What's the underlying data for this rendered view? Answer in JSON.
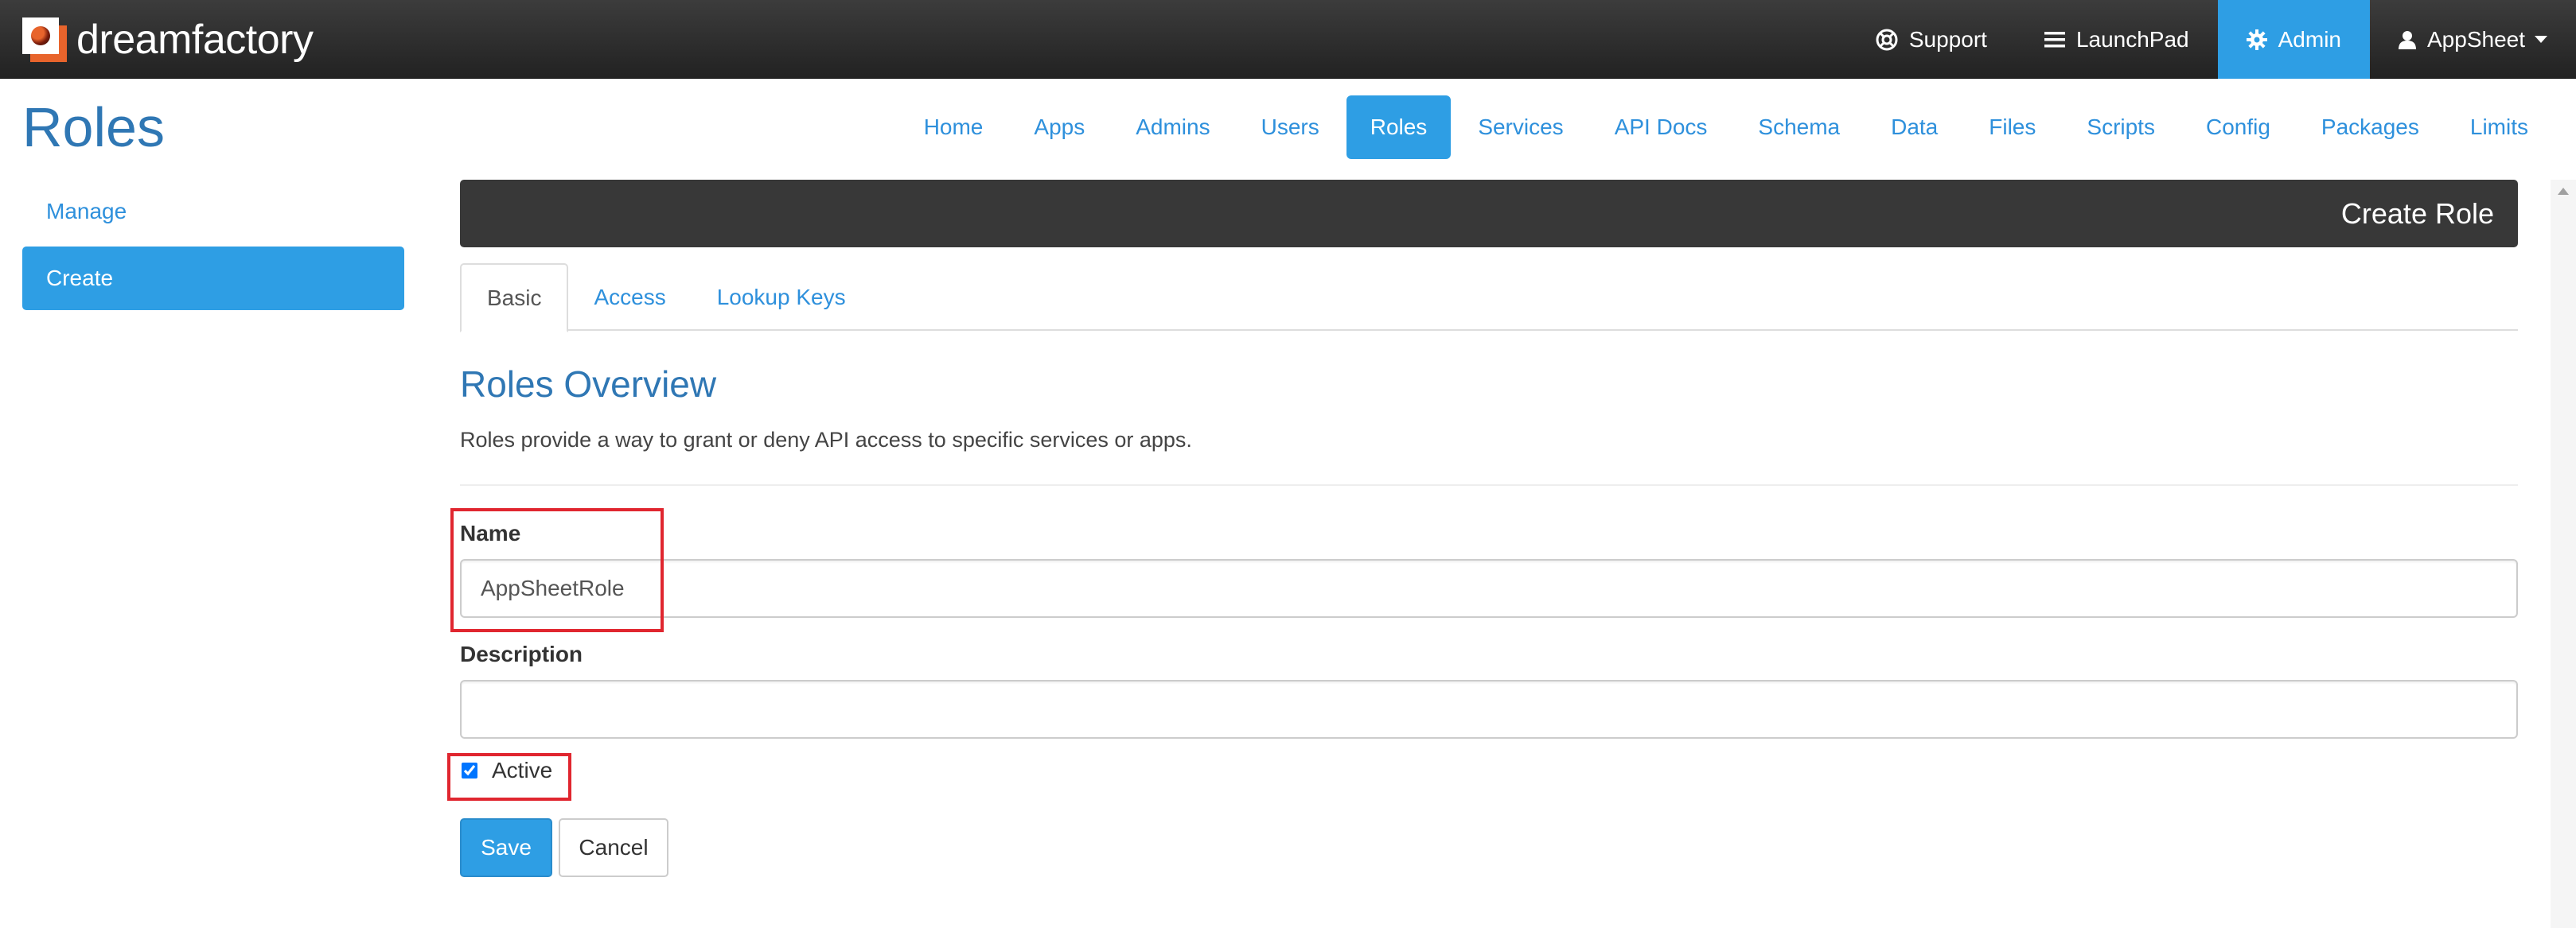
{
  "navbar": {
    "brand": "dreamfactory",
    "items": [
      {
        "label": "Support",
        "icon": "life-ring-icon"
      },
      {
        "label": "LaunchPad",
        "icon": "bars-icon"
      },
      {
        "label": "Admin",
        "icon": "gear-icon",
        "active": true
      },
      {
        "label": "AppSheet",
        "icon": "user-icon"
      }
    ]
  },
  "page": {
    "title": "Roles"
  },
  "admin_nav": [
    {
      "label": "Home"
    },
    {
      "label": "Apps"
    },
    {
      "label": "Admins"
    },
    {
      "label": "Users"
    },
    {
      "label": "Roles",
      "active": true
    },
    {
      "label": "Services"
    },
    {
      "label": "API Docs"
    },
    {
      "label": "Schema"
    },
    {
      "label": "Data"
    },
    {
      "label": "Files"
    },
    {
      "label": "Scripts"
    },
    {
      "label": "Config"
    },
    {
      "label": "Packages"
    },
    {
      "label": "Limits"
    }
  ],
  "sidebar": {
    "items": [
      {
        "label": "Manage"
      },
      {
        "label": "Create",
        "active": true
      }
    ]
  },
  "panel": {
    "header": "Create Role"
  },
  "tabs": [
    {
      "label": "Basic",
      "active": true
    },
    {
      "label": "Access"
    },
    {
      "label": "Lookup Keys"
    }
  ],
  "overview": {
    "title": "Roles Overview",
    "description": "Roles provide a way to grant or deny API access to specific services or apps."
  },
  "form": {
    "name_label": "Name",
    "name_value": "AppSheetRole",
    "description_label": "Description",
    "description_value": "",
    "active_label": "Active",
    "active_checked": true,
    "save_label": "Save",
    "cancel_label": "Cancel"
  },
  "colors": {
    "accent": "#2e9ee4",
    "highlight": "#e0262f",
    "title": "#2f77b4"
  }
}
